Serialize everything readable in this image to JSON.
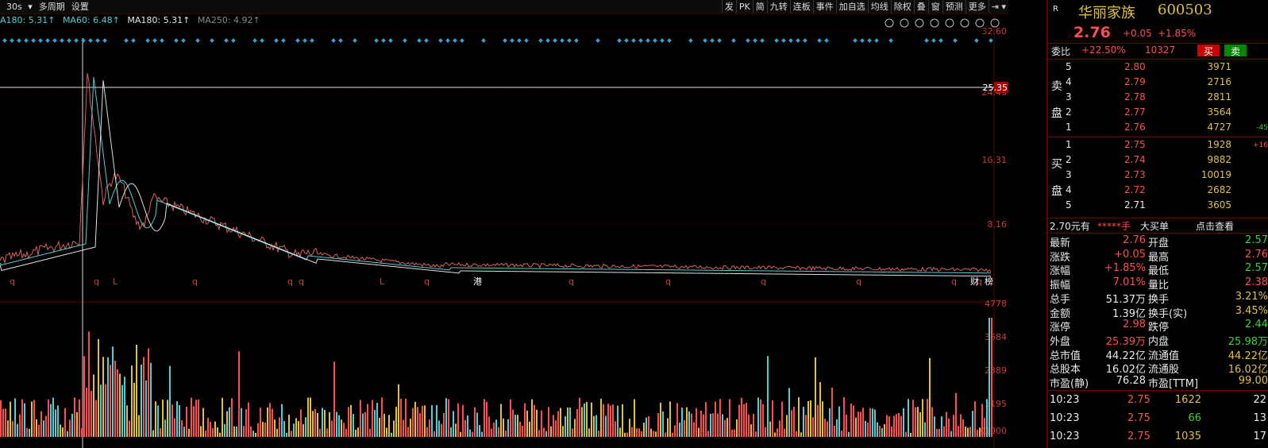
{
  "toolbar": {
    "period": "30s",
    "multi_period": "多周期",
    "settings": "设置",
    "buttons": [
      "发",
      "PK",
      "简",
      "九转",
      "连板",
      "事件",
      "加自选",
      "均线",
      "除权",
      "叠",
      "窗",
      "预测",
      "更多"
    ]
  },
  "ma_line": {
    "ma180_left": "A180: 5.31↑",
    "ma60": "MA60: 6.48↑",
    "ma180": "MA180: 5.31↑",
    "ma250": "MA250: 4.92↑"
  },
  "price_axis": [
    "32.60",
    "24.45",
    "16.31",
    "8.16"
  ],
  "crosshair_price": "25.35",
  "vol_axis": [
    "4778",
    "3584",
    "2389",
    "1195",
    "X1000"
  ],
  "markers_bottom": [
    "q",
    "q",
    "L",
    "q",
    "q",
    "q",
    "L",
    "q",
    "港",
    "q",
    "q",
    "q",
    "q",
    "q",
    "q",
    "财",
    "榜"
  ],
  "stock": {
    "badge": "R",
    "name": "华丽家族",
    "code": "600503",
    "price": "2.76",
    "change": "+0.05",
    "change_pct": "+1.85%",
    "buy_btn": "买",
    "sell_btn": "卖",
    "wei_bi_label": "委比",
    "wei_bi": "+22.50%",
    "wei_cha": "10327"
  },
  "asks": [
    {
      "lvl": "5",
      "price": "2.80",
      "vol": "3971",
      "chg": ""
    },
    {
      "lvl": "4",
      "price": "2.79",
      "vol": "2716",
      "chg": ""
    },
    {
      "lvl": "3",
      "price": "2.78",
      "vol": "2811",
      "chg": ""
    },
    {
      "lvl": "2",
      "price": "2.77",
      "vol": "3564",
      "chg": ""
    },
    {
      "lvl": "1",
      "price": "2.76",
      "vol": "4727",
      "chg": "-45"
    }
  ],
  "bids": [
    {
      "lvl": "1",
      "price": "2.75",
      "vol": "1928",
      "chg": "+16"
    },
    {
      "lvl": "2",
      "price": "2.74",
      "vol": "9882",
      "chg": ""
    },
    {
      "lvl": "3",
      "price": "2.73",
      "vol": "10019",
      "chg": ""
    },
    {
      "lvl": "4",
      "price": "2.72",
      "vol": "2682",
      "chg": ""
    },
    {
      "lvl": "5",
      "price": "2.71",
      "vol": "3605",
      "chg": ""
    }
  ],
  "ask_label": [
    "卖",
    "盘"
  ],
  "bid_label": [
    "买",
    "盘"
  ],
  "big_order": {
    "price": "2.70元有",
    "amount": "*****手",
    "label": "大买单",
    "link": "点击查看"
  },
  "stats": [
    {
      "l": "最新",
      "lv": "2.76",
      "r": "开盘",
      "rv": "2.57"
    },
    {
      "l": "涨跌",
      "lv": "+0.05",
      "r": "最高",
      "rv": "2.76"
    },
    {
      "l": "涨幅",
      "lv": "+1.85%",
      "r": "最低",
      "rv": "2.57"
    },
    {
      "l": "振幅",
      "lv": "7.01%",
      "r": "量比",
      "rv": "2.38"
    },
    {
      "l": "总手",
      "lv": "51.37万",
      "r": "换手",
      "rv": "3.21%"
    },
    {
      "l": "金额",
      "lv": "1.39亿",
      "r": "换手(实)",
      "rv": "3.45%"
    },
    {
      "l": "涨停",
      "lv": "2.98",
      "r": "跌停",
      "rv": "2.44"
    },
    {
      "l": "外盘",
      "lv": "25.39万",
      "r": "内盘",
      "rv": "25.98万"
    },
    {
      "l": "总市值",
      "lv": "44.22亿",
      "r": "流通值",
      "rv": "44.22亿"
    },
    {
      "l": "总股本",
      "lv": "16.02亿",
      "r": "流通股",
      "rv": "16.02亿"
    },
    {
      "l": "市盈(静)",
      "lv": "76.28",
      "r": "市盈[TTM]",
      "rv": "99.00"
    }
  ],
  "ticks": [
    {
      "time": "10:23",
      "price": "2.75",
      "vol": "1622",
      "n": "22"
    },
    {
      "time": "10:23",
      "price": "2.75",
      "vol": "66",
      "n": "13"
    },
    {
      "time": "10:23",
      "price": "2.75",
      "vol": "1035",
      "n": "17"
    }
  ],
  "colors": {
    "up": "#ff4d4d",
    "down": "#34d534",
    "ma": "#4fd0d8",
    "bg": "#000000"
  }
}
